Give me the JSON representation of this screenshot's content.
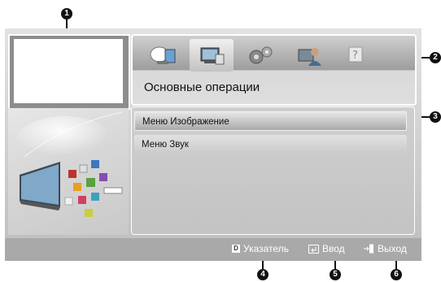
{
  "callouts": [
    "1",
    "2",
    "3",
    "4",
    "5",
    "6"
  ],
  "header": {
    "label": "Основные операции",
    "tabs": [
      {
        "icon": "satellite-dish-icon",
        "active": false
      },
      {
        "icon": "tv-manual-icon",
        "active": true
      },
      {
        "icon": "gears-icon",
        "active": false
      },
      {
        "icon": "person-monitor-icon",
        "active": false
      },
      {
        "icon": "question-icon",
        "active": false
      }
    ]
  },
  "menu": {
    "items": [
      "Меню Изображение",
      "Меню Звук"
    ]
  },
  "footer": {
    "index_key": "D",
    "index_label": "Указатель",
    "enter_label": "Ввод",
    "exit_label": "Выход"
  },
  "colors": {
    "frame": "#cfcfcf",
    "footer": "#a9a9a9",
    "text": "#111111",
    "accent_badge": "#111111"
  }
}
